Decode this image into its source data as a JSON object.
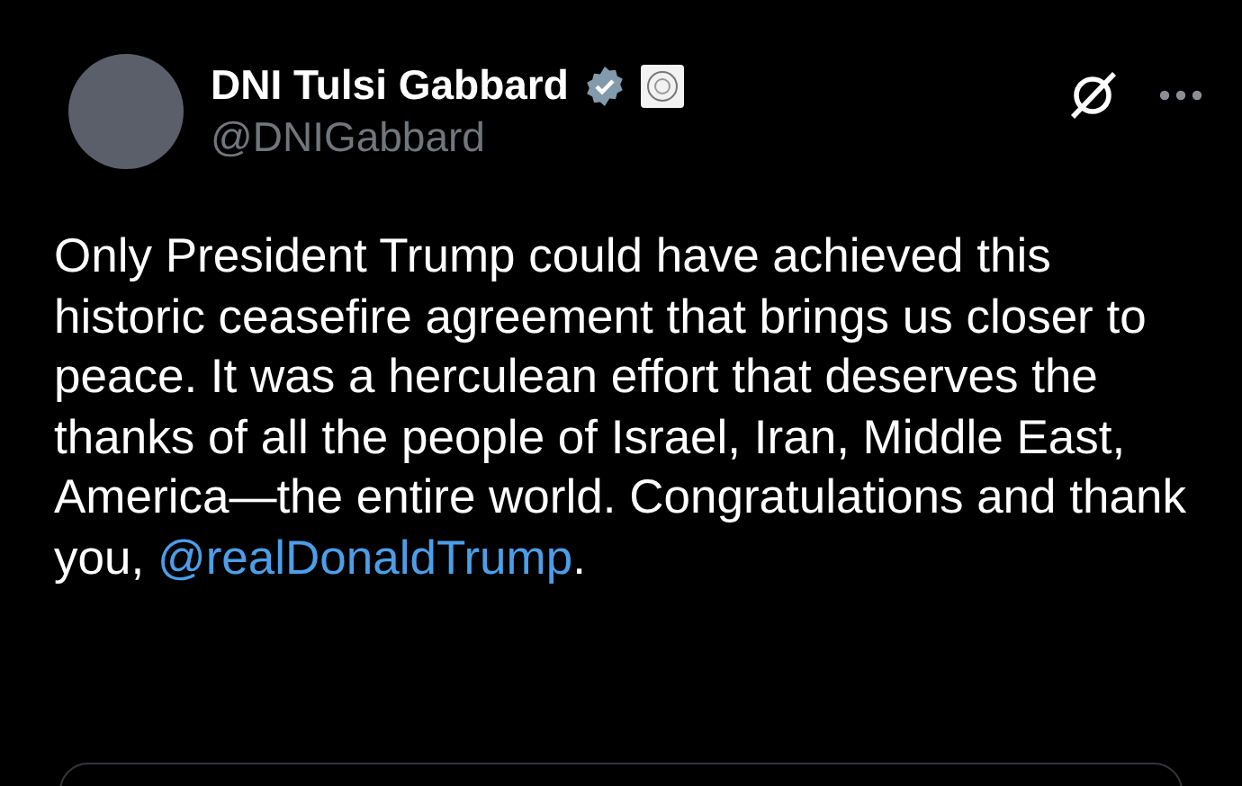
{
  "author": {
    "name": "DNI Tulsi Gabbard",
    "handle": "@DNIGabbard",
    "verified": true
  },
  "post": {
    "text": "Only President Trump could have achieved this historic ceasefire agreement that brings us closer to peace. It was a herculean effort that deserves the thanks of all the people of Israel, Iran, Middle East, America—the entire world. Congratulations and thank you, ",
    "mention": "@realDonaldTrump",
    "text_after": "."
  }
}
